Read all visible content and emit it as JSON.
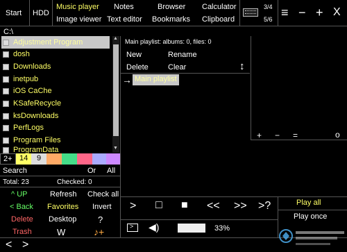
{
  "topbar": {
    "start": "Start",
    "hdd": "HDD",
    "apps": [
      {
        "label": "Music player",
        "active": true
      },
      {
        "label": "Notes",
        "active": false
      },
      {
        "label": "Browser",
        "active": false
      },
      {
        "label": "Calculator",
        "active": false
      },
      {
        "label": "Image viewer",
        "active": false
      },
      {
        "label": "Text editor",
        "active": false
      },
      {
        "label": "Bookmarks",
        "active": false
      },
      {
        "label": "Clipboard",
        "active": false
      }
    ],
    "page_top": "3/4",
    "page_bottom": "5/6",
    "menu": "≡",
    "minimize": "−",
    "add": "+",
    "close": "X"
  },
  "path": "C:\\",
  "files": [
    "Adjustment Program",
    "dosh",
    "Downloads",
    "inetpub",
    "iOS CaChe",
    "KSafeRecycle",
    "ksDownloads",
    "PerfLogs",
    "Program Files",
    "ProgramData"
  ],
  "swatches": {
    "counts": [
      "2+",
      "14",
      "9"
    ],
    "colors": [
      "#000000",
      "#ffff66",
      "#dddddd",
      "#ffaa66",
      "#44dd88",
      "#ff6688",
      "#aaaaff",
      "#cc88ff"
    ]
  },
  "search": {
    "label": "Search",
    "or": "Or",
    "all": "All"
  },
  "totals": {
    "total": "Total: 23",
    "checked": "Checked: 0"
  },
  "actions": {
    "up": "^  UP",
    "refresh": "Refresh",
    "check_all": "Check all",
    "back": "<  Back",
    "favorites": "Favorites",
    "invert": "Invert",
    "delete": "Delete",
    "desktop": "Desktop",
    "help": "?",
    "trash": "Trash",
    "w": "W",
    "note": "♪+"
  },
  "playlist": {
    "info": "Main playlist:  albums: 0,  files: 0",
    "new": "New",
    "rename": "Rename",
    "delete": "Delete",
    "clear": "Clear",
    "current": "Main playlist"
  },
  "eq": {
    "plus": "+",
    "minus": "−",
    "eq": "=",
    "circle": "o"
  },
  "player": {
    "play": ">",
    "stop": "□",
    "pause": "■",
    "prev": "<<",
    "next": ">>",
    "random": ">?",
    "volume": "33%",
    "volume_level": 0.33,
    "mode_all": "Play all",
    "mode_once": "Play once"
  },
  "bottom": {
    "left": "<",
    "right": ">"
  }
}
